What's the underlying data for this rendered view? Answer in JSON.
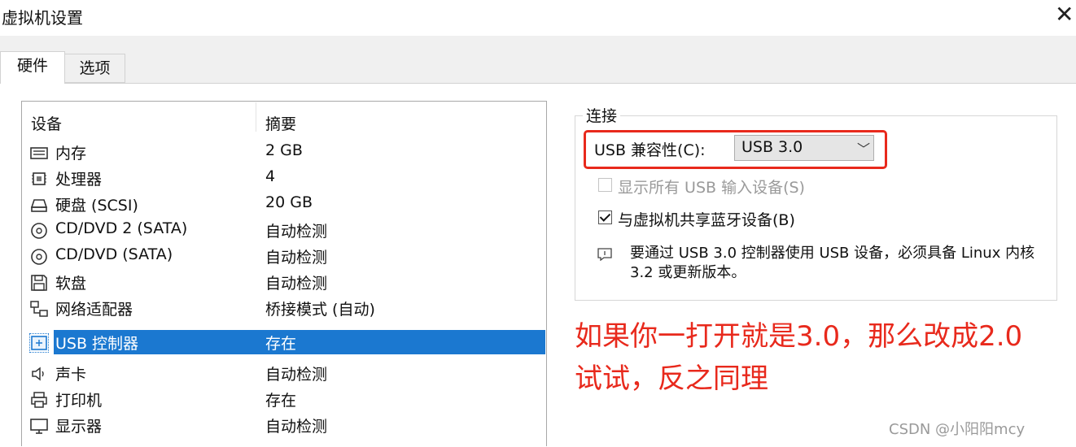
{
  "window": {
    "title": "虚拟机设置",
    "close_glyph": "✕"
  },
  "tabs": [
    {
      "label": "硬件",
      "active": true
    },
    {
      "label": "选项",
      "active": false
    }
  ],
  "device_list": {
    "headers": {
      "device": "设备",
      "summary": "摘要"
    },
    "rows": [
      {
        "name": "内存",
        "summary": "2 GB",
        "icon": "memory-icon"
      },
      {
        "name": "处理器",
        "summary": "4",
        "icon": "cpu-icon"
      },
      {
        "name": "硬盘 (SCSI)",
        "summary": "20 GB",
        "icon": "harddisk-icon"
      },
      {
        "name": "CD/DVD 2 (SATA)",
        "summary": "自动检测",
        "icon": "cd-icon"
      },
      {
        "name": "CD/DVD (SATA)",
        "summary": "自动检测",
        "icon": "cd-icon"
      },
      {
        "name": "软盘",
        "summary": "自动检测",
        "icon": "floppy-icon"
      },
      {
        "name": "网络适配器",
        "summary": "桥接模式 (自动)",
        "icon": "network-icon"
      },
      {
        "name": "USB 控制器",
        "summary": "存在",
        "icon": "usb-icon",
        "selected": true
      },
      {
        "name": "声卡",
        "summary": "自动检测",
        "icon": "sound-icon"
      },
      {
        "name": "打印机",
        "summary": "存在",
        "icon": "printer-icon"
      },
      {
        "name": "显示器",
        "summary": "自动检测",
        "icon": "monitor-icon"
      }
    ]
  },
  "connection": {
    "group_title": "连接",
    "usb_compat_label": "USB 兼容性(C):",
    "usb_compat_value": "USB 3.0",
    "show_all_usb": {
      "label": "显示所有 USB 输入设备(S)",
      "checked": false,
      "enabled": false
    },
    "share_bluetooth": {
      "label": "与虚拟机共享蓝牙设备(B)",
      "checked": true,
      "enabled": true
    },
    "info_text": "要通过 USB 3.0 控制器使用 USB 设备，必须具备 Linux 内核 3.2 或更新版本。"
  },
  "annotation": {
    "line1": "如果你一打开就是3.0，那么改成2.0",
    "line2": "试试，反之同理",
    "color": "#e8291c"
  },
  "watermark": "CSDN @小阳阳mcy",
  "colors": {
    "selection": "#1b78d0",
    "highlight_border": "#e8291c"
  }
}
